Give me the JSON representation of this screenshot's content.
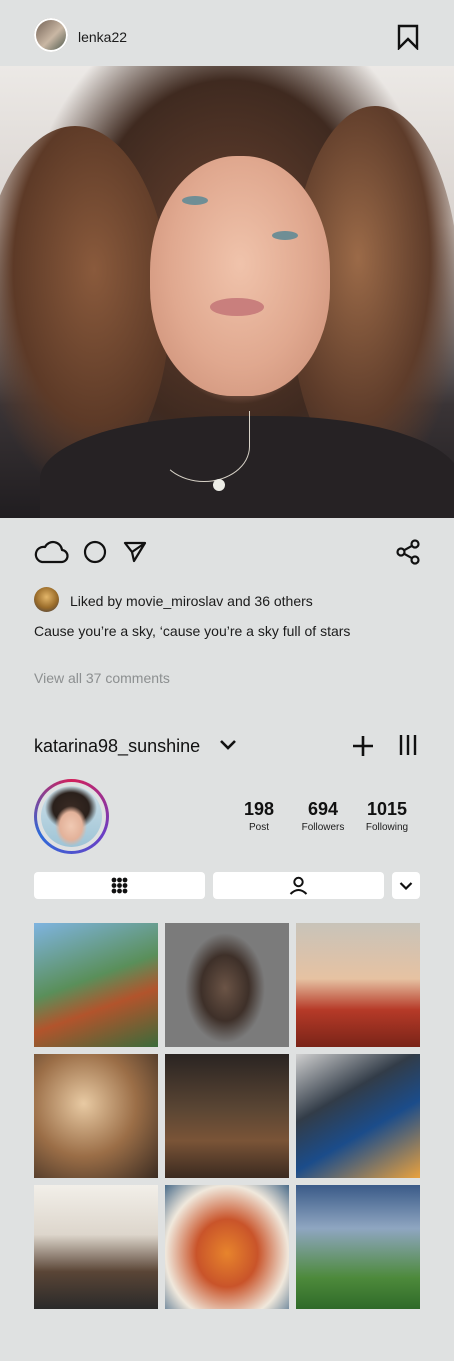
{
  "post": {
    "username": "lenka22",
    "likes_text": "Liked by movie_miroslav and 36 others",
    "caption": "Cause you’re a sky, ‘cause you’re a sky full of stars",
    "view_comments": "View all 37 comments"
  },
  "profile": {
    "username": "katarina98_sunshine",
    "stats": [
      {
        "value": "198",
        "label": "Post"
      },
      {
        "value": "694",
        "label": "Followers"
      },
      {
        "value": "1015",
        "label": "Following"
      }
    ]
  },
  "icons": {
    "bookmark": "bookmark-icon",
    "like": "cloud-icon",
    "comment": "circle-icon",
    "send": "send-icon",
    "share": "share-icon",
    "dropdown": "chevron-down-icon",
    "add": "plus-icon",
    "menu": "menu-icon",
    "grid_tab": "grid-icon",
    "tagged_tab": "person-icon"
  },
  "colors": {
    "background": "#dfe1e1",
    "story_ring": [
      "#d21f5a",
      "#6a3fc5",
      "#2f6ad8"
    ],
    "muted_text": "#8c8f90"
  }
}
